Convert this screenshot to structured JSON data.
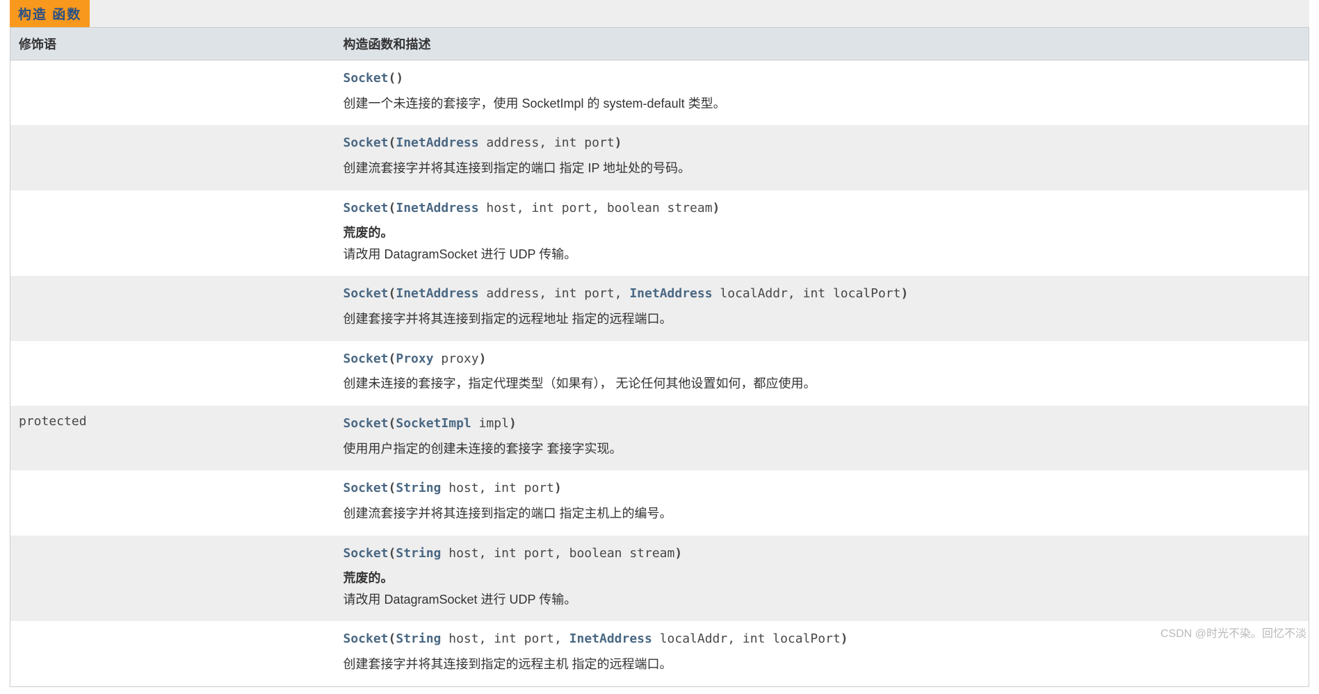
{
  "section_title": "构造 函数",
  "columns": {
    "modifier": "修饰语",
    "desc": "构造函数和描述"
  },
  "rows": [
    {
      "modifier": "",
      "method": "Socket",
      "sig_tokens": [
        {
          "t": "punct",
          "v": "()"
        }
      ],
      "description": "创建一个未连接的套接字，使用 SocketImpl 的 system-default 类型。"
    },
    {
      "modifier": "",
      "method": "Socket",
      "sig_tokens": [
        {
          "t": "punct",
          "v": "("
        },
        {
          "t": "type",
          "v": "InetAddress"
        },
        {
          "t": "plain",
          "v": " address, int port"
        },
        {
          "t": "punct",
          "v": ")"
        }
      ],
      "description": "创建流套接字并将其连接到指定的端口 指定 IP 地址处的号码。"
    },
    {
      "modifier": "",
      "method": "Socket",
      "sig_tokens": [
        {
          "t": "punct",
          "v": "("
        },
        {
          "t": "type",
          "v": "InetAddress"
        },
        {
          "t": "plain",
          "v": " host, int port, boolean stream"
        },
        {
          "t": "punct",
          "v": ")"
        }
      ],
      "deprecated": "荒废的。",
      "description": "请改用 DatagramSocket 进行 UDP 传输。"
    },
    {
      "modifier": "",
      "method": "Socket",
      "sig_tokens": [
        {
          "t": "punct",
          "v": "("
        },
        {
          "t": "type",
          "v": "InetAddress"
        },
        {
          "t": "plain",
          "v": " address, int port, "
        },
        {
          "t": "type",
          "v": "InetAddress"
        },
        {
          "t": "plain",
          "v": " localAddr, int localPort"
        },
        {
          "t": "punct",
          "v": ")"
        }
      ],
      "description": "创建套接字并将其连接到指定的远程地址 指定的远程端口。"
    },
    {
      "modifier": "",
      "method": "Socket",
      "sig_tokens": [
        {
          "t": "punct",
          "v": "("
        },
        {
          "t": "type",
          "v": "Proxy"
        },
        {
          "t": "plain",
          "v": " proxy"
        },
        {
          "t": "punct",
          "v": ")"
        }
      ],
      "description": "创建未连接的套接字，指定代理类型（如果有）， 无论任何其他设置如何，都应使用。"
    },
    {
      "modifier": "protected ",
      "method": "Socket",
      "sig_tokens": [
        {
          "t": "punct",
          "v": "("
        },
        {
          "t": "type",
          "v": "SocketImpl"
        },
        {
          "t": "plain",
          "v": " impl"
        },
        {
          "t": "punct",
          "v": ")"
        }
      ],
      "description": "使用用户指定的创建未连接的套接字 套接字实现。"
    },
    {
      "modifier": "",
      "method": "Socket",
      "sig_tokens": [
        {
          "t": "punct",
          "v": "("
        },
        {
          "t": "type",
          "v": "String"
        },
        {
          "t": "plain",
          "v": " host, int port"
        },
        {
          "t": "punct",
          "v": ")"
        }
      ],
      "description": "创建流套接字并将其连接到指定的端口 指定主机上的编号。"
    },
    {
      "modifier": "",
      "method": "Socket",
      "sig_tokens": [
        {
          "t": "punct",
          "v": "("
        },
        {
          "t": "type",
          "v": "String"
        },
        {
          "t": "plain",
          "v": " host, int port, boolean stream"
        },
        {
          "t": "punct",
          "v": ")"
        }
      ],
      "deprecated": "荒废的。",
      "description": "请改用 DatagramSocket 进行 UDP 传输。"
    },
    {
      "modifier": "",
      "method": "Socket",
      "sig_tokens": [
        {
          "t": "punct",
          "v": "("
        },
        {
          "t": "type",
          "v": "String"
        },
        {
          "t": "plain",
          "v": " host, int port, "
        },
        {
          "t": "type",
          "v": "InetAddress"
        },
        {
          "t": "plain",
          "v": " localAddr, int localPort"
        },
        {
          "t": "punct",
          "v": ")"
        }
      ],
      "description": "创建套接字并将其连接到指定的远程主机 指定的远程端口。"
    }
  ],
  "watermark": "CSDN @时光不染。回忆不淡"
}
